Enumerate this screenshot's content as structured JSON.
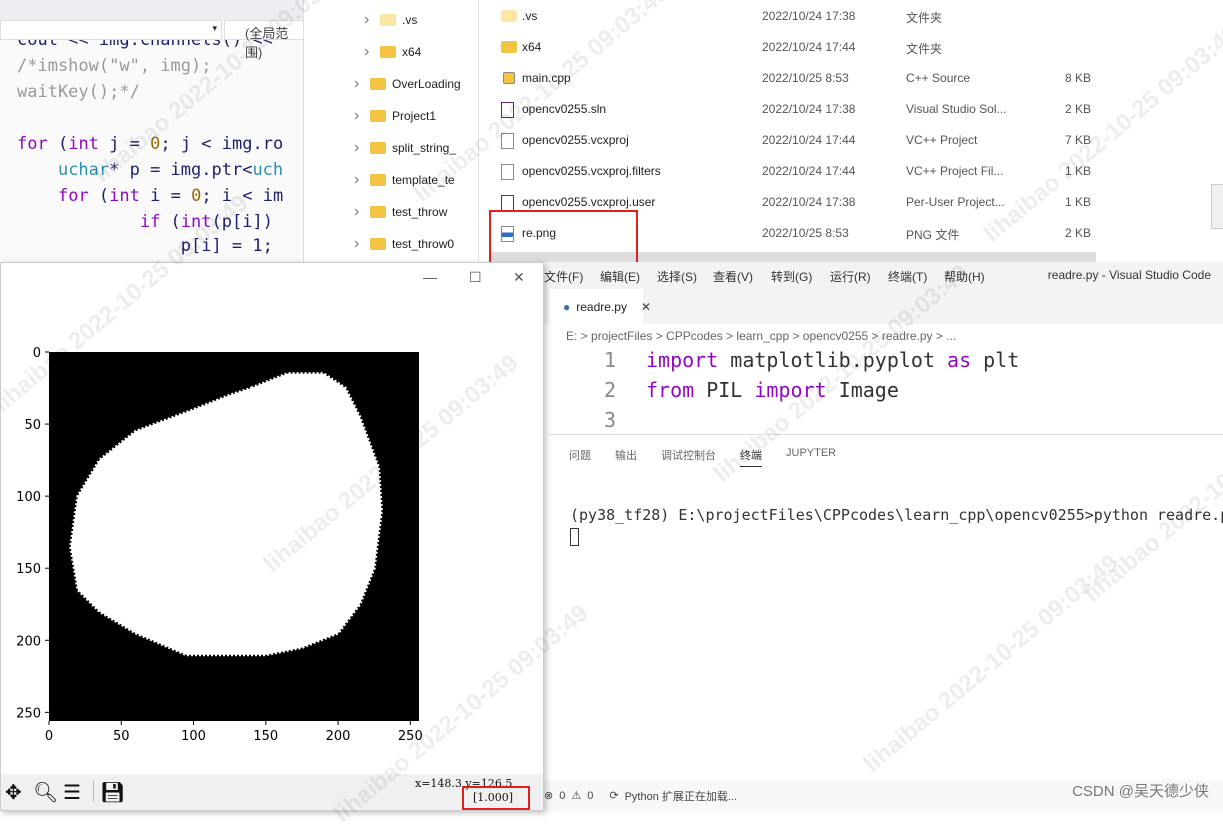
{
  "vs_editor": {
    "scope_dropdown": "(全局范围)",
    "code_lines": [
      "cout << img.channels() <<",
      "/*imshow(\"w\", img);",
      "waitKey();*/",
      "",
      "for (int j = 0; j < img.ro",
      "    uchar* p = img.ptr<uch",
      "    for (int i = 0; i < im",
      "            if (int(p[i])",
      "                p[i] = 1;"
    ]
  },
  "tree": {
    "items": [
      ".vs",
      "x64",
      "OverLoading",
      "Project1",
      "split_string_",
      "template_te",
      "test_throw",
      "test_throw0"
    ]
  },
  "files": [
    {
      "name": ".vs",
      "date": "2022/10/24 17:38",
      "type": "文件夹",
      "size": "",
      "icon": "folder-icon"
    },
    {
      "name": "x64",
      "date": "2022/10/24 17:44",
      "type": "文件夹",
      "size": "",
      "icon": "folder-icon"
    },
    {
      "name": "main.cpp",
      "date": "2022/10/25 8:53",
      "type": "C++ Source",
      "size": "8 KB",
      "icon": "cpp-file-icon"
    },
    {
      "name": "opencv0255.sln",
      "date": "2022/10/24 17:38",
      "type": "Visual Studio Sol...",
      "size": "2 KB",
      "icon": "sln-file-icon"
    },
    {
      "name": "opencv0255.vcxproj",
      "date": "2022/10/24 17:44",
      "type": "VC++ Project",
      "size": "7 KB",
      "icon": "file-icon"
    },
    {
      "name": "opencv0255.vcxproj.filters",
      "date": "2022/10/24 17:44",
      "type": "VC++ Project Fil...",
      "size": "1 KB",
      "icon": "file-icon"
    },
    {
      "name": "opencv0255.vcxproj.user",
      "date": "2022/10/24 17:38",
      "type": "Per-User Project...",
      "size": "1 KB",
      "icon": "user-file-icon"
    },
    {
      "name": "re.png",
      "date": "2022/10/25 8:53",
      "type": "PNG 文件",
      "size": "2 KB",
      "icon": "png-file-icon"
    }
  ],
  "figure": {
    "coord_readout": "x=148.3 y=126.5",
    "pixel_value": "[1.000]",
    "chart_data": {
      "type": "image",
      "xlim": [
        0,
        256
      ],
      "ylim": [
        256,
        0
      ],
      "xticks": [
        "0",
        "50",
        "100",
        "150",
        "200",
        "250"
      ],
      "yticks": [
        "0",
        "50",
        "100",
        "150",
        "200",
        "250"
      ],
      "colors": {
        "background": "#000000",
        "foreground": "#ffffff"
      }
    }
  },
  "vscode": {
    "menu": [
      "文件(F)",
      "编辑(E)",
      "选择(S)",
      "查看(V)",
      "转到(G)",
      "运行(R)",
      "终端(T)",
      "帮助(H)"
    ],
    "title": "readre.py - Visual Studio Code",
    "tab": "readre.py",
    "breadcrumb": "E: > projectFiles > CPPcodes > learn_cpp > opencv0255 > readre.py > ...",
    "lines": [
      {
        "n": "1",
        "code": [
          [
            "kw",
            "import"
          ],
          [
            "pl",
            " matplotlib.pyplot "
          ],
          [
            "kw",
            "as"
          ],
          [
            "pl",
            " plt"
          ]
        ]
      },
      {
        "n": "2",
        "code": [
          [
            "kw",
            "from"
          ],
          [
            "pl",
            " PIL "
          ],
          [
            "kw",
            "import"
          ],
          [
            "pl",
            " Image"
          ]
        ]
      },
      {
        "n": "3",
        "code": []
      }
    ],
    "panel_tabs": [
      "问题",
      "输出",
      "调试控制台",
      "终端",
      "JUPYTER"
    ],
    "active_panel": "终端",
    "terminal": "(py38_tf28) E:\\projectFiles\\CPPcodes\\learn_cpp\\opencv0255>python readre.p",
    "status": {
      "errors": "0",
      "warnings": "0",
      "python": "Python 扩展正在加载..."
    }
  },
  "watermark": "lihaibao 2022-10-25 09:03:49",
  "csdn": "CSDN @吴天德少侠"
}
